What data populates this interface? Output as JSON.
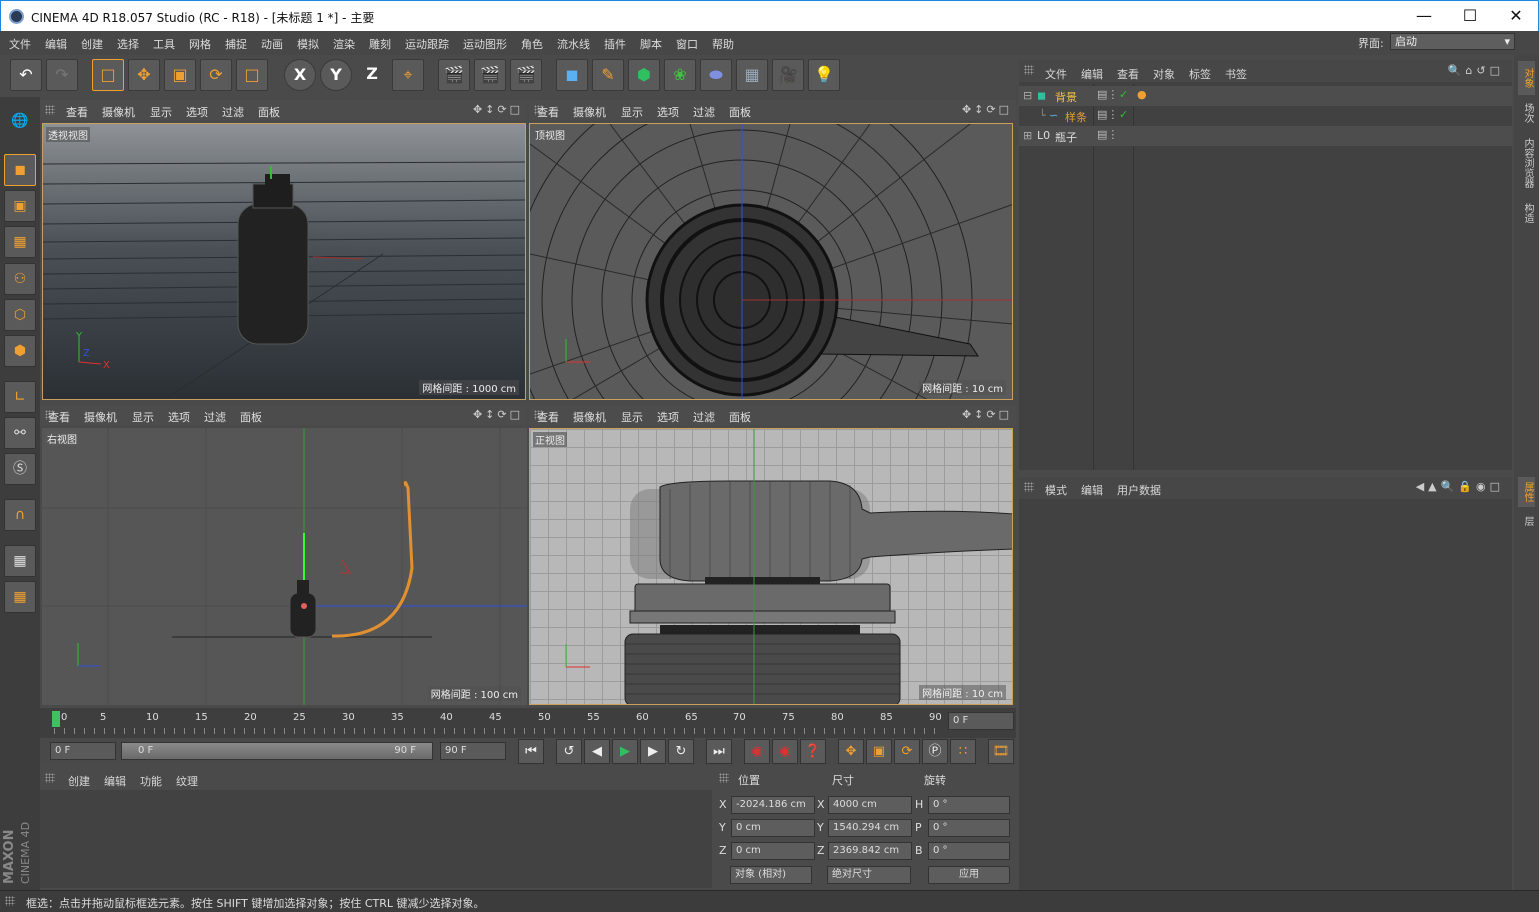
{
  "window": {
    "title": "CINEMA 4D R18.057 Studio (RC - R18) - [未标题 1 *] - 主要"
  },
  "menu": [
    "文件",
    "编辑",
    "创建",
    "选择",
    "工具",
    "网格",
    "捕捉",
    "动画",
    "模拟",
    "渲染",
    "雕刻",
    "运动跟踪",
    "运动图形",
    "角色",
    "流水线",
    "插件",
    "脚本",
    "窗口",
    "帮助"
  ],
  "interface": {
    "label": "界面:",
    "value": "启动"
  },
  "axis_buttons": {
    "x": "X",
    "y": "Y",
    "z": "Z"
  },
  "viewport_menu": [
    "查看",
    "摄像机",
    "显示",
    "选项",
    "过滤",
    "面板"
  ],
  "viewports": [
    {
      "name": "透视视图",
      "grid": "网格间距 : 1000 cm"
    },
    {
      "name": "顶视图",
      "grid": "网格间距 : 10 cm"
    },
    {
      "name": "右视图",
      "grid": "网格间距 : 100 cm"
    },
    {
      "name": "正视图",
      "grid": "网格间距 : 10 cm"
    }
  ],
  "timeline": {
    "ticks": [
      "0",
      "5",
      "10",
      "15",
      "20",
      "25",
      "30",
      "35",
      "40",
      "45",
      "50",
      "55",
      "60",
      "65",
      "70",
      "75",
      "80",
      "85",
      "90"
    ],
    "current_frame": "0 F",
    "start": "0 F",
    "range_start": "0 F",
    "range_end": "90 F",
    "end": "90 F"
  },
  "material_panel": {
    "menu": [
      "创建",
      "编辑",
      "功能",
      "纹理"
    ]
  },
  "coordinates": {
    "headers": {
      "position": "位置",
      "size": "尺寸",
      "rotation": "旋转"
    },
    "rows": [
      {
        "axis": "X",
        "pos": "-2024.186 cm",
        "size_axis": "X",
        "size": "4000 cm",
        "rot_axis": "H",
        "rot": "0 °"
      },
      {
        "axis": "Y",
        "pos": "0 cm",
        "size_axis": "Y",
        "size": "1540.294 cm",
        "rot_axis": "P",
        "rot": "0 °"
      },
      {
        "axis": "Z",
        "pos": "0 cm",
        "size_axis": "Z",
        "size": "2369.842 cm",
        "rot_axis": "B",
        "rot": "0 °"
      }
    ],
    "mode": "对象 (相对)",
    "size_mode": "绝对尺寸",
    "apply": "应用"
  },
  "object_manager": {
    "menu": [
      "文件",
      "编辑",
      "查看",
      "对象",
      "标签",
      "书签"
    ],
    "objects": [
      {
        "name": "背景",
        "color": "#f0c040"
      },
      {
        "name": "样条",
        "color": "#e0a030"
      },
      {
        "name": "瓶子",
        "color": "#dddddd"
      }
    ]
  },
  "attribute_manager": {
    "menu": [
      "模式",
      "编辑",
      "用户数据"
    ]
  },
  "right_tabs": [
    "对象",
    "场次",
    "内容浏览器",
    "构造",
    "属性",
    "层"
  ],
  "brand": {
    "maxon": "MAXON",
    "product": "CINEMA 4D"
  },
  "status": "框选：点击并拖动鼠标框选元素。按住 SHIFT 键增加选择对象；按住 CTRL 键减少选择对象。",
  "colors": {
    "accent": "#f0a030",
    "selected_border": "#c8a060",
    "axis_x": "#e03030",
    "axis_y": "#30c030",
    "axis_z": "#3050e0"
  }
}
